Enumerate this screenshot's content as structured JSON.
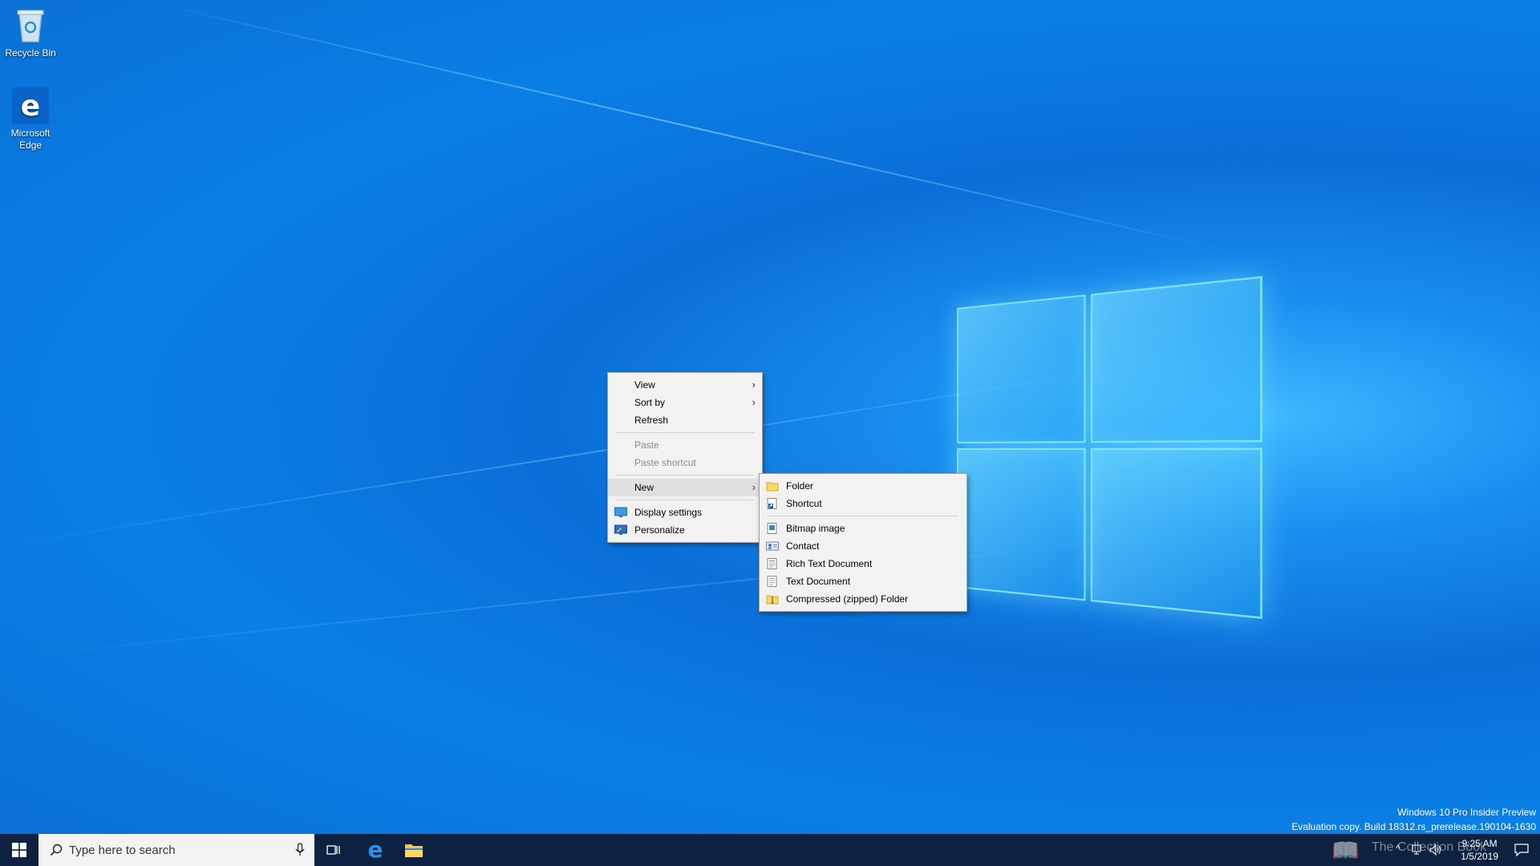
{
  "desktop": {
    "icons": [
      {
        "label": "Recycle Bin"
      },
      {
        "label": "Microsoft Edge"
      }
    ],
    "edge_label_line1": "Microsoft",
    "edge_label_line2": "Edge"
  },
  "context_menu": {
    "items": [
      {
        "label": "View",
        "has_submenu": true
      },
      {
        "label": "Sort by",
        "has_submenu": true
      },
      {
        "label": "Refresh"
      },
      {
        "label": "Paste",
        "disabled": true
      },
      {
        "label": "Paste shortcut",
        "disabled": true
      },
      {
        "label": "New",
        "has_submenu": true,
        "active": true
      },
      {
        "label": "Display settings",
        "icon": "display-icon"
      },
      {
        "label": "Personalize",
        "icon": "personalize-icon"
      }
    ]
  },
  "new_submenu": {
    "items": [
      {
        "label": "Folder",
        "icon": "folder-icon"
      },
      {
        "label": "Shortcut",
        "icon": "shortcut-icon"
      },
      {
        "label": "Bitmap image",
        "icon": "bitmap-icon"
      },
      {
        "label": "Contact",
        "icon": "contact-icon"
      },
      {
        "label": "Rich Text Document",
        "icon": "rich-text-icon"
      },
      {
        "label": "Text Document",
        "icon": "text-document-icon"
      },
      {
        "label": "Compressed (zipped) Folder",
        "icon": "zip-folder-icon"
      }
    ]
  },
  "taskbar": {
    "search_placeholder": "Type here to search",
    "clock_time": "9:25 AM",
    "clock_date": "1/5/2019"
  },
  "watermark": {
    "line1": "Windows 10 Pro Insider Preview",
    "line2": "Evaluation copy. Build 18312.rs_prerelease.190104-1630",
    "overlay": "The Collection Book"
  },
  "colors": {
    "taskbar": "#0c2240",
    "menu_bg": "#f2f2f2",
    "accent": "#0a78d7"
  }
}
